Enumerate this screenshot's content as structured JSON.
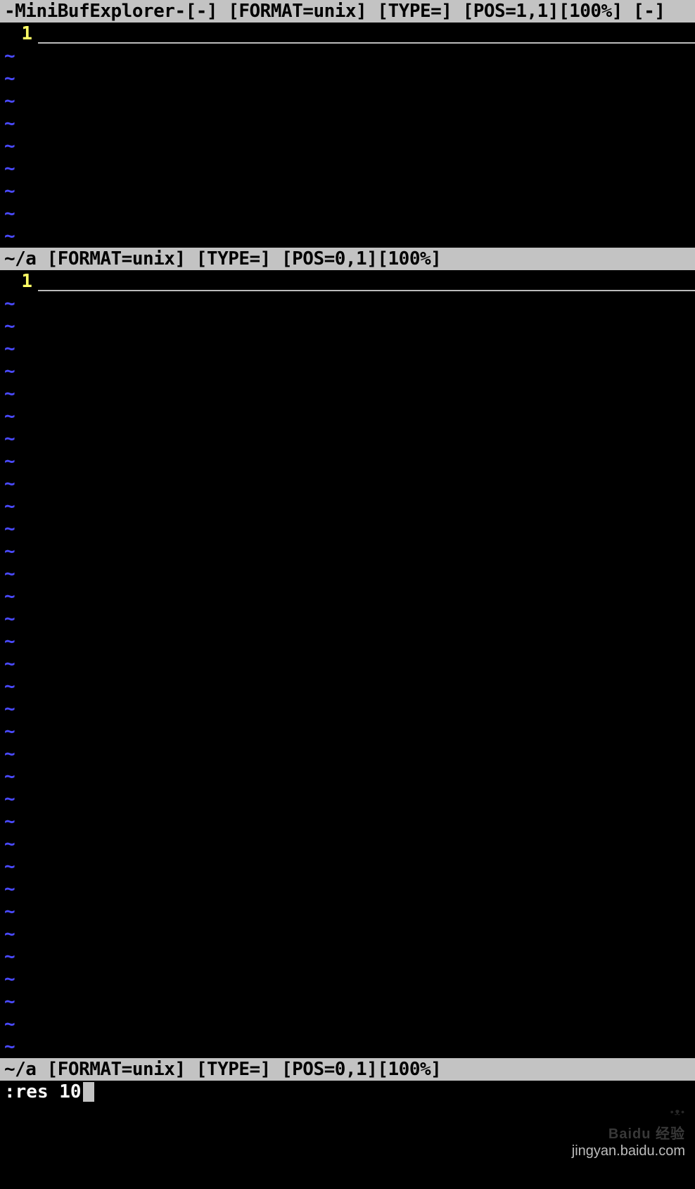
{
  "top_status": "-MiniBufExplorer-[-] [FORMAT=unix] [TYPE=] [POS=1,1][100%] [-]",
  "split1": {
    "line_number": "1",
    "tilde_rows": 9
  },
  "mid_status": "~/a [FORMAT=unix] [TYPE=] [POS=0,1][100%]",
  "split2": {
    "line_number": "1",
    "tilde_rows": 34
  },
  "bottom_status": "~/a [FORMAT=unix] [TYPE=] [POS=0,1][100%]",
  "command_line": ":res 10",
  "watermark_brand": "Baidu 经验",
  "watermark_url": "jingyan.baidu.com",
  "colors": {
    "bg": "#000000",
    "statusbar_bg": "#c3c3c3",
    "statusbar_fg": "#000000",
    "linenum": "#ffff66",
    "tilde": "#4a4aff"
  }
}
